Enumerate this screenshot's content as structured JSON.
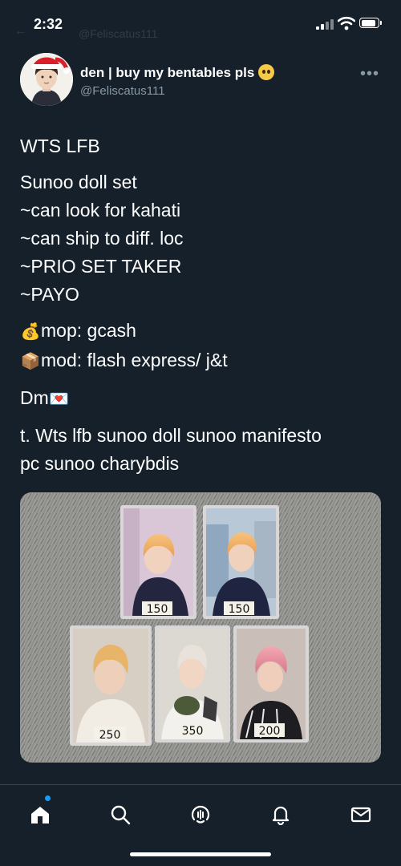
{
  "status": {
    "time": "2:32"
  },
  "ghost_header": {
    "title": "@Feliscatus111"
  },
  "author": {
    "display_name": "den | buy my bentables pls",
    "handle": "@Feliscatus111",
    "emoji": "pleading-face"
  },
  "tweet": {
    "line1": "WTS LFB",
    "line2": "Sunoo doll set",
    "line3": "~can look for kahati",
    "line4": "~can ship to diff. loc",
    "line5": "~PRIO SET TAKER",
    "line6": "~PAYO",
    "mop": "mop: gcash",
    "mod": "mod: flash express/ j&t",
    "dm": "Dm",
    "tags_line1": "t. Wts lfb sunoo doll sunoo manifesto",
    "tags_line2": "pc sunoo charybdis",
    "icons": {
      "mop": "money-bag-icon",
      "mod": "package-icon",
      "dm": "love-letter-icon"
    }
  },
  "photo": {
    "prices": [
      "150",
      "150",
      "250",
      "350",
      "200"
    ]
  },
  "nav": {
    "items": [
      "home-icon",
      "search-icon",
      "spaces-icon",
      "notifications-icon",
      "messages-icon"
    ],
    "accent": "#1d9bf0"
  },
  "colors": {
    "background": "#15202b",
    "secondary_text": "#8899a6"
  }
}
